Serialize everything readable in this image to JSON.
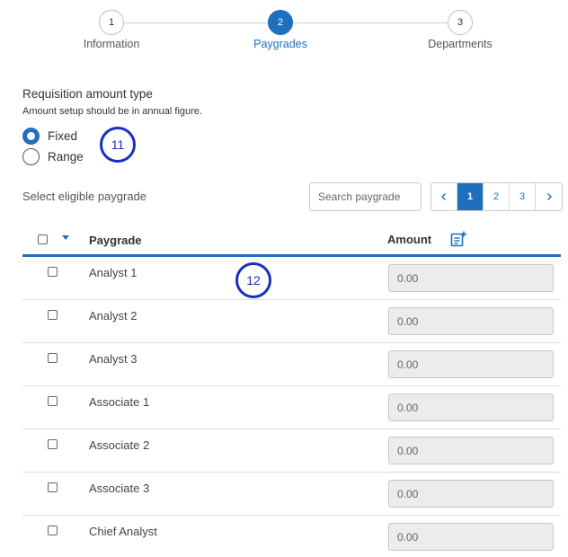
{
  "stepper": {
    "steps": [
      {
        "number": "1",
        "label": "Information"
      },
      {
        "number": "2",
        "label": "Paygrades"
      },
      {
        "number": "3",
        "label": "Departments"
      }
    ]
  },
  "requisition": {
    "title": "Requisition amount type",
    "subtitle": "Amount setup should be in annual figure.",
    "options": [
      {
        "label": "Fixed",
        "checked": true
      },
      {
        "label": "Range",
        "checked": false
      }
    ]
  },
  "callouts": [
    "11",
    "12"
  ],
  "toolbar": {
    "label": "Select eligible paygrade",
    "search_placeholder": "Search paygrade",
    "pagination": {
      "prev": "‹",
      "pages": [
        "1",
        "2",
        "3"
      ],
      "next": "›",
      "current": "1"
    }
  },
  "table": {
    "headers": {
      "paygrade": "Paygrade",
      "amount": "Amount"
    },
    "icons": {
      "sort": "caret-down-icon",
      "amount_action": "note-add-icon"
    },
    "rows": [
      {
        "paygrade": "Analyst 1",
        "amount": "0.00"
      },
      {
        "paygrade": "Analyst 2",
        "amount": "0.00"
      },
      {
        "paygrade": "Analyst 3",
        "amount": "0.00"
      },
      {
        "paygrade": "Associate 1",
        "amount": "0.00"
      },
      {
        "paygrade": "Associate 2",
        "amount": "0.00"
      },
      {
        "paygrade": "Associate 3",
        "amount": "0.00"
      },
      {
        "paygrade": "Chief Analyst",
        "amount": "0.00"
      }
    ]
  },
  "colors": {
    "accent": "#1f6fbf",
    "callout": "#1a2fc0"
  }
}
